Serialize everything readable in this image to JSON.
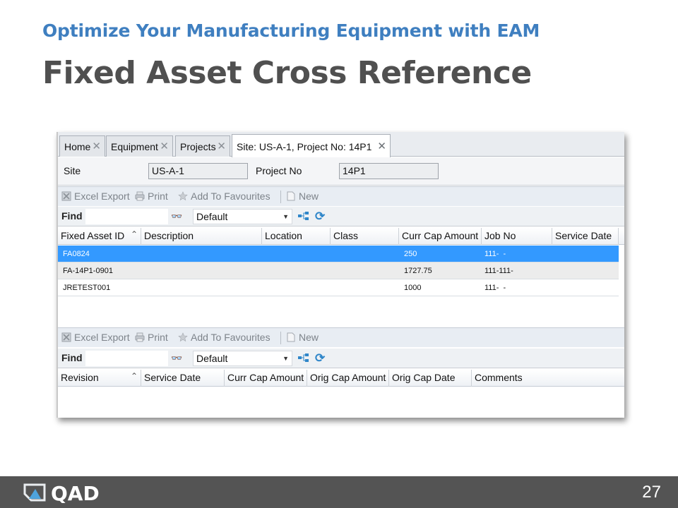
{
  "slide": {
    "subtitle": "Optimize Your Manufacturing Equipment with EAM",
    "title": "Fixed Asset Cross Reference",
    "page_number": "27",
    "logo_text": "QAD"
  },
  "tabs": [
    {
      "label": "Home"
    },
    {
      "label": "Equipment"
    },
    {
      "label": "Projects"
    },
    {
      "label": "Site: US-A-1, Project No: 14P1"
    }
  ],
  "header_fields": {
    "site_label": "Site",
    "site_value": "US-A-1",
    "project_label": "Project No",
    "project_value": "14P1"
  },
  "toolbar": {
    "excel_export": "Excel Export",
    "print": "Print",
    "add_to_favourites": "Add To Favourites",
    "new": "New"
  },
  "find": {
    "label": "Find",
    "value": "",
    "view_selected": "Default"
  },
  "assets_grid": {
    "columns": [
      "Fixed Asset ID",
      "Description",
      "Location",
      "Class",
      "Curr Cap Amount",
      "Job No",
      "Service Date"
    ],
    "rows": [
      {
        "id": "FA0824",
        "description": "",
        "location": "",
        "class": "",
        "curr_cap_amount": "250",
        "job_no": "111-  -",
        "service_date": "",
        "selected": true
      },
      {
        "id": "FA-14P1-0901",
        "description": "",
        "location": "",
        "class": "",
        "curr_cap_amount": "1727.75",
        "job_no": "111-111-",
        "service_date": "",
        "selected": false
      },
      {
        "id": "JRETEST001",
        "description": "",
        "location": "",
        "class": "",
        "curr_cap_amount": "1000",
        "job_no": "111-  -",
        "service_date": "",
        "selected": false
      }
    ]
  },
  "revisions_grid": {
    "columns": [
      "Revision",
      "Service Date",
      "Curr Cap Amount",
      "Orig Cap Amount",
      "Orig Cap Date",
      "Comments"
    ],
    "rows": []
  },
  "colors": {
    "subtitle": "#3f7fc0",
    "title": "#505050",
    "selected_row": "#3399ff",
    "footer": "#545454"
  }
}
